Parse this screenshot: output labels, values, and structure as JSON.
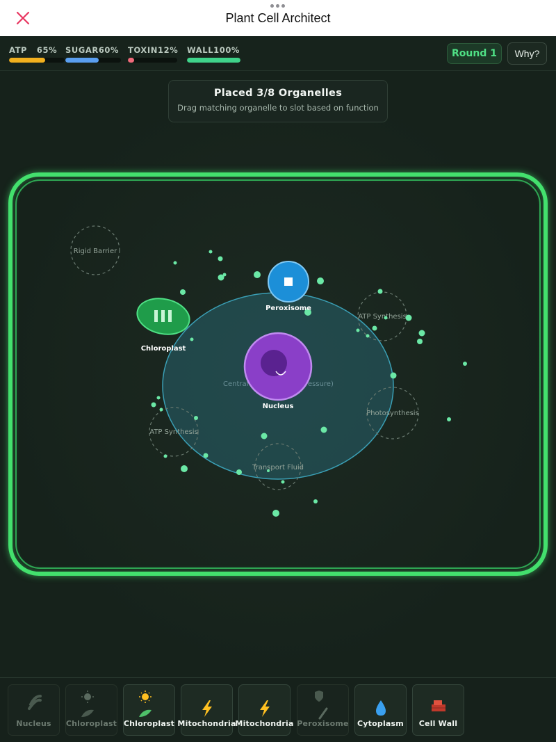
{
  "header": {
    "title": "Plant Cell Architect",
    "close_icon": "close-icon"
  },
  "stats": [
    {
      "label": "ATP",
      "value": "65%",
      "level": 0.65,
      "color": "#f2b01e"
    },
    {
      "label": "SUGAR",
      "value": "60%",
      "level": 0.6,
      "color": "#5a9ff0"
    },
    {
      "label": "TOXIN",
      "value": "12%",
      "level": 0.12,
      "color": "#f06a7a"
    },
    {
      "label": "WALL",
      "value": "100%",
      "level": 1.0,
      "color": "#3fd38a"
    }
  ],
  "round_label": "Round 1",
  "why_label": "Why?",
  "info": {
    "heading": "Placed 3/8 Organelles",
    "subtext": "Drag matching organelle to slot based on function"
  },
  "slots": {
    "rigid_barrier": "Rigid Barrier",
    "atp_synthesis_right": "ATP Synthesis",
    "atp_synthesis_left": "ATP Synthesis",
    "photosynthesis": "Photosynthesis",
    "transport_fluid": "Transport Fluid",
    "vacuole_left": "Central",
    "vacuole_right": "essure)"
  },
  "placed": {
    "peroxisome": "Peroxisome",
    "chloroplast": "Chloroplast",
    "nucleus": "Nucleus"
  },
  "tray": [
    {
      "label": "Nucleus",
      "icon": "dna-icon",
      "available": false
    },
    {
      "label": "Chloroplast",
      "icon": "sun-leaf-icon",
      "available": false
    },
    {
      "label": "Chloroplast",
      "icon": "sun-leaf-icon",
      "available": true
    },
    {
      "label": "Mitochondria",
      "icon": "lightning-icon",
      "available": true
    },
    {
      "label": "Mitochondria",
      "icon": "lightning-icon",
      "available": true
    },
    {
      "label": "Peroxisome",
      "icon": "shield-sword-icon",
      "available": false
    },
    {
      "label": "Cytoplasm",
      "icon": "droplet-icon",
      "available": true
    },
    {
      "label": "Cell Wall",
      "icon": "brick-icon",
      "available": true
    }
  ],
  "colors": {
    "wall_green": "#43e06d",
    "vacuole": "#2f8fa8",
    "nucleus": "#9b4fd6",
    "peroxisome": "#1c8fd8",
    "chloroplast": "#1f9c4a",
    "particle": "#6be8a6"
  }
}
